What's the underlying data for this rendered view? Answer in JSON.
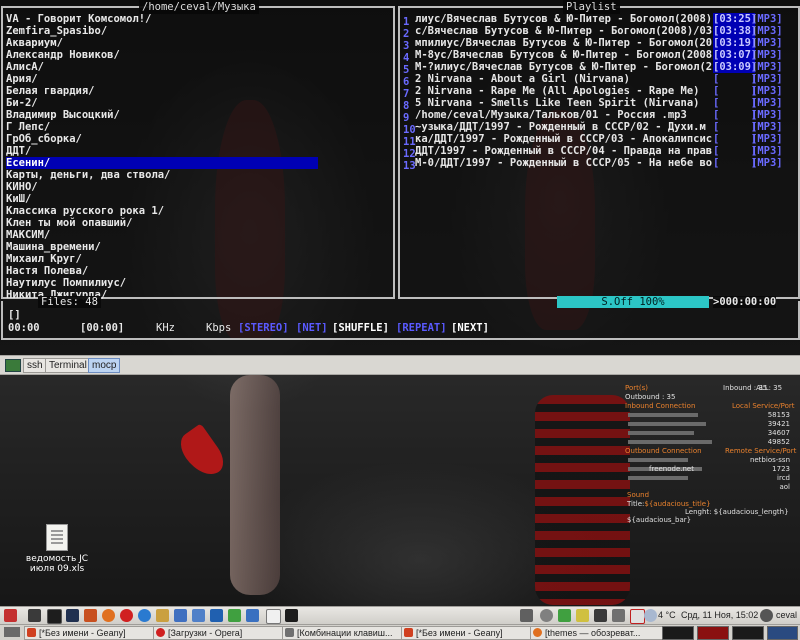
{
  "terminal": {
    "dir_title": "/home/ceval/Музыка",
    "playlist_title": "Playlist",
    "dir_items": [
      "VA - Говорит Комсомол!/",
      "Zemfira_Spasibo/",
      "Аквариум/",
      "Александр Новиков/",
      "АлисА/",
      "Ария/",
      "Белая гвардия/",
      "Би-2/",
      "Владимир Высоцкий/",
      "Г Лепс/",
      "ГрОб_сборка/",
      "ДДТ/",
      "Есенин/",
      "Карты, деньги, два ствола/",
      "КИНО/",
      "КиШ/",
      "Классика русского рока 1/",
      "Клен ты мой опавший/",
      "МАКСИМ/",
      "Машина_времени/",
      "Михаил Круг/",
      "Настя Полева/",
      "Наутилус Помпилиус/",
      "Никита Джигурда/"
    ],
    "selected_index": 12,
    "files_label": "Files: 48",
    "playlist": [
      {
        "n": "1",
        "title": "лиус/Вячеслав Бутусов & Ю-Питер - Богомол(2008)",
        "time": "03:25",
        "fmt": "MP3",
        "filled": true
      },
      {
        "n": "2",
        "title": "с/Вячеслав Бутусов & Ю-Питер - Богомол(2008)/03",
        "time": "03:38",
        "fmt": "MP3",
        "filled": true
      },
      {
        "n": "3",
        "title": "мпилиус/Вячеслав Бутусов & Ю-Питер - Богомол(20",
        "time": "03:19",
        "fmt": "MP3",
        "filled": true
      },
      {
        "n": "4",
        "title": "М-8ус/Вячеслав Бутусов & Ю-Питер - Богомол(2008",
        "time": "03:07",
        "fmt": "MP3",
        "filled": true
      },
      {
        "n": "5",
        "title": "М-?илиус/Вячеслав Бутусов & Ю-Питер - Богомол(2",
        "time": "03:09",
        "fmt": "MP3",
        "filled": true
      },
      {
        "n": "6",
        "title": "2 Nirvana - About a Girl (Nirvana)",
        "time": "",
        "fmt": "MP3",
        "filled": false
      },
      {
        "n": "7",
        "title": "2 Nirvana - Rape Me (All Apologies - Rape Me)",
        "time": "",
        "fmt": "MP3",
        "filled": false
      },
      {
        "n": "8",
        "title": "5 Nirvana - Smells Like Teen Spirit (Nirvana)",
        "time": "",
        "fmt": "MP3",
        "filled": false
      },
      {
        "n": "9",
        "title": "/home/ceval/Музыка/Тальков/01 - Россия .mp3",
        "time": "",
        "fmt": "MP3",
        "filled": false
      },
      {
        "n": "10",
        "title": "~узыка/ДДТ/1997 - Рожденный в СССР/02 - Духи.м",
        "time": "",
        "fmt": "MP3",
        "filled": false
      },
      {
        "n": "11",
        "title": "ка/ДДТ/1997 - Рожденный в СССР/03 - Апокалипсис",
        "time": "",
        "fmt": "MP3",
        "filled": false
      },
      {
        "n": "12",
        "title": "ДДТ/1997 - Рожденный в СССР/04 - Правда на прав",
        "time": "",
        "fmt": "MP3",
        "filled": false
      },
      {
        "n": "13",
        "title": "М-0/ДДТ/1997 - Рожденный в СССР/05 - На небе во",
        "time": "",
        "fmt": "MP3",
        "filled": false
      }
    ],
    "softmixer": "S.Off 100%",
    "time_total": ">000:00:00",
    "cur_title": "[]",
    "time_played": "00:00",
    "time_left": "[00:00]",
    "khz": "KHz",
    "kbps": "Kbps",
    "flags": {
      "stereo": "[STEREO]",
      "net": "[NET]",
      "shuffle": "[SHUFFLE]",
      "repeat": "[REPEAT]",
      "next": "[NEXT]"
    }
  },
  "tabs": [
    "ssh",
    "Terminal",
    "mocp"
  ],
  "active_tab": 2,
  "conky": {
    "header": "Port(s)",
    "inbound_count": "Inbound : 35",
    "all_count": "ALL: 35",
    "outbound_count": "Outbound : 35",
    "inbound_connection": "Inbound Connection",
    "local_service_port": "Local Service/Port",
    "local_ports": [
      "58153",
      "39421",
      "34607",
      "49852"
    ],
    "outbound_connection": "Outbound Connection",
    "remote_service_port": "Remote Service/Port",
    "remote_ports": [
      "netbios-ssn",
      "1723",
      "ircd",
      "aol"
    ],
    "remote_host": "freenode.net",
    "sound_label": "Sound",
    "title_line_label": "Title:",
    "title_var": "${audacious_title}",
    "length_line_label": "Lenght:",
    "length_var": "${audacious_length}",
    "bar_var": "${audacious_bar}"
  },
  "desktop_file": "ведомость JC июля 09.xls",
  "tray": {
    "temp": "4 °C",
    "clock": "Срд, 11 Ноя, 15:02",
    "user": "ceval"
  },
  "tasks": [
    "[*Без имени - Geany]",
    "[Загрузки - Opera]",
    "[Комбинации клавиш...",
    "[*Без имени - Geany]",
    "[themes — обозреват..."
  ]
}
